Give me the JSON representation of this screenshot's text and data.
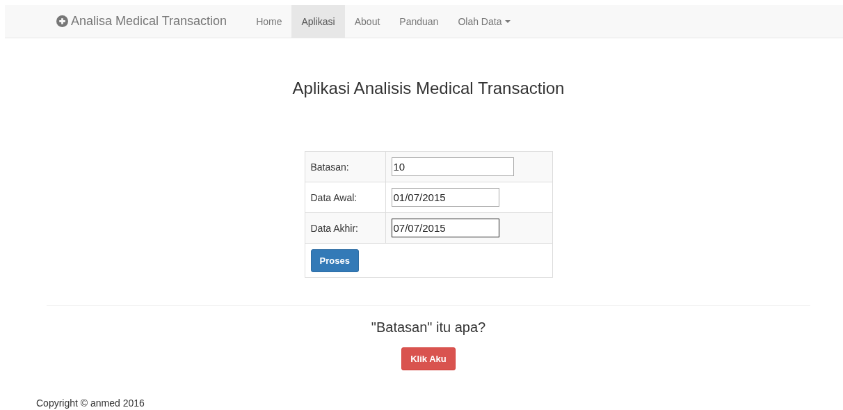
{
  "navbar": {
    "brand": "Analisa Medical Transaction",
    "items": [
      {
        "label": "Home",
        "selected": false,
        "dropdown": false
      },
      {
        "label": "Aplikasi",
        "selected": true,
        "dropdown": false
      },
      {
        "label": "About",
        "selected": false,
        "dropdown": false
      },
      {
        "label": "Panduan",
        "selected": false,
        "dropdown": false
      },
      {
        "label": "Olah Data",
        "selected": false,
        "dropdown": true
      }
    ]
  },
  "heading": "Aplikasi Analisis Medical Transaction",
  "form": {
    "fields": [
      {
        "label": "Batasan:",
        "value": "10",
        "focused": false
      },
      {
        "label": "Data Awal:",
        "value": "01/07/2015",
        "focused": false
      },
      {
        "label": "Data Akhir:",
        "value": "07/07/2015",
        "focused": true
      }
    ],
    "submit": "Proses"
  },
  "help": {
    "question": "\"Batasan\" itu apa?",
    "button": "Klik Aku"
  },
  "footer": "Copyright © anmed 2016"
}
